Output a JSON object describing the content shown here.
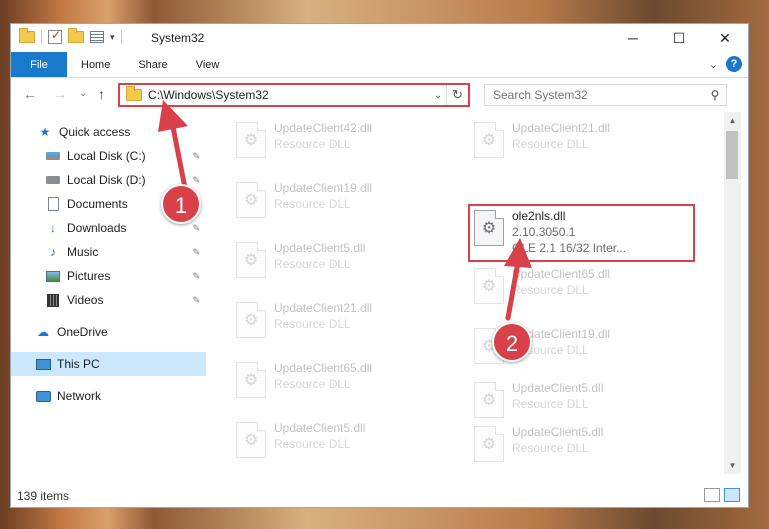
{
  "window": {
    "title": "System32",
    "minimize_icon": "─",
    "maximize_icon": "☐",
    "close_icon": "✕"
  },
  "ribbon": {
    "file": "File",
    "home": "Home",
    "share": "Share",
    "view": "View",
    "expand_icon": "⌄",
    "help": "?"
  },
  "navigation": {
    "back": "←",
    "forward": "→",
    "recent": "⌄",
    "up": "↑"
  },
  "address": {
    "path": "C:\\Windows\\System32",
    "dropdown": "⌄",
    "refresh": "↻"
  },
  "search": {
    "placeholder": "Search System32",
    "icon": "⚲"
  },
  "sidebar": {
    "items": [
      {
        "label": "Quick access"
      },
      {
        "label": "Local Disk (C:)"
      },
      {
        "label": "Local Disk (D:)"
      },
      {
        "label": "Documents"
      },
      {
        "label": "Downloads"
      },
      {
        "label": "Music"
      },
      {
        "label": "Pictures"
      },
      {
        "label": "Videos"
      },
      {
        "label": "OneDrive"
      },
      {
        "label": "This PC"
      },
      {
        "label": "Network"
      }
    ],
    "pin_icon": "📌"
  },
  "files": {
    "left": [
      {
        "name": "UpdateClient42.dll",
        "sub": "Resource DLL"
      },
      {
        "name": "UpdateClient19.dll",
        "sub": "Resource DLL"
      },
      {
        "name": "UpdateClient5.dll",
        "sub": "Resource DLL"
      },
      {
        "name": "UpdateClient21.dll",
        "sub": "Resource DLL"
      },
      {
        "name": "UpdateClient65.dll",
        "sub": "Resource DLL"
      },
      {
        "name": "UpdateClient5.dll",
        "sub": "Resource DLL"
      }
    ],
    "right": [
      {
        "name": "UpdateClient21.dll",
        "sub": "Resource DLL"
      },
      {
        "name": "ole2nls.dll",
        "version": "2.10.3050.1",
        "description": "OLE 2.1 16/32 Inter..."
      },
      {
        "name": "UpdateClient65.dll",
        "sub": "Resource DLL"
      },
      {
        "name": "UpdateClient19.dll",
        "sub": "Resource DLL"
      },
      {
        "name": "UpdateClient5.dll",
        "sub": "Resource DLL"
      },
      {
        "name": "UpdateClient5.dll",
        "sub": "Resource DLL"
      }
    ],
    "file_icon": "⚙"
  },
  "status": {
    "item_count": "139 items"
  },
  "annotations": {
    "step1": "1",
    "step2": "2",
    "color": "#d9414a"
  }
}
